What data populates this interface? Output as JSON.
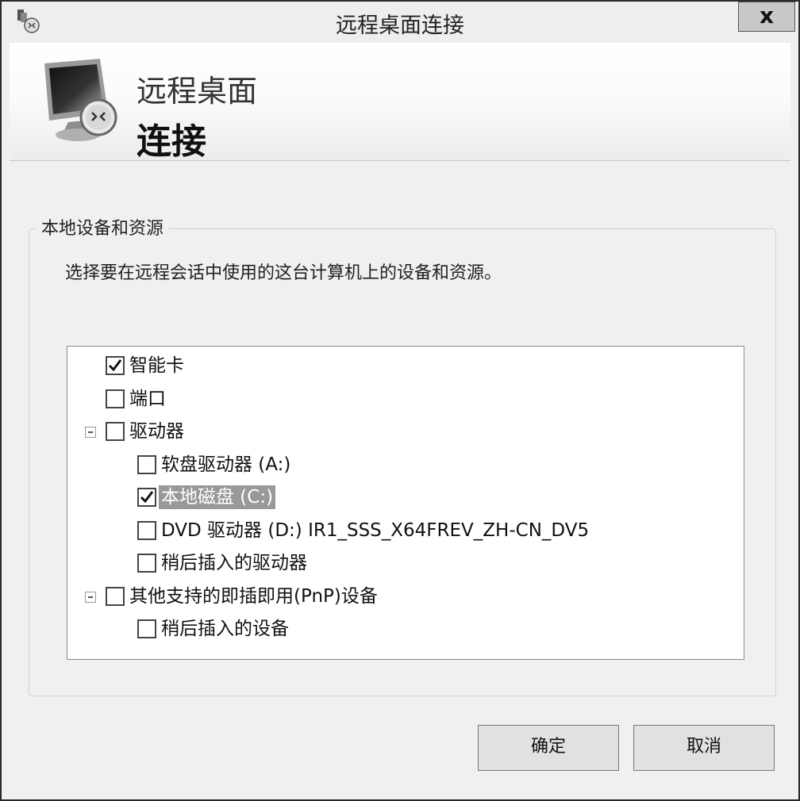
{
  "window": {
    "title": "远程桌面连接",
    "close_glyph": "x",
    "app_icon": "rdp-app-icon"
  },
  "banner": {
    "line1": "远程桌面",
    "line2": "连接",
    "icon": "monitor-icon"
  },
  "group": {
    "legend": "本地设备和资源",
    "description": "选择要在远程会话中使用的这台计算机上的设备和资源。"
  },
  "tree": {
    "items": [
      {
        "label": "智能卡",
        "checked": true,
        "level": 0,
        "expander": false,
        "selected": false
      },
      {
        "label": "端口",
        "checked": false,
        "level": 0,
        "expander": false,
        "selected": false
      },
      {
        "label": "驱动器",
        "checked": false,
        "level": 0,
        "expander": true,
        "selected": false
      },
      {
        "label": "软盘驱动器 (A:)",
        "checked": false,
        "level": 1,
        "expander": false,
        "selected": false
      },
      {
        "label": "本地磁盘 (C:)",
        "checked": true,
        "level": 1,
        "expander": false,
        "selected": true
      },
      {
        "label": "DVD 驱动器 (D:) IR1_SSS_X64FREV_ZH-CN_DV5",
        "checked": false,
        "level": 1,
        "expander": false,
        "selected": false
      },
      {
        "label": "稍后插入的驱动器",
        "checked": false,
        "level": 1,
        "expander": false,
        "selected": false
      },
      {
        "label": "其他支持的即插即用(PnP)设备",
        "checked": false,
        "level": 0,
        "expander": true,
        "selected": false
      },
      {
        "label": "稍后插入的设备",
        "checked": false,
        "level": 1,
        "expander": false,
        "selected": false
      }
    ]
  },
  "buttons": {
    "ok": "确定",
    "cancel": "取消"
  }
}
